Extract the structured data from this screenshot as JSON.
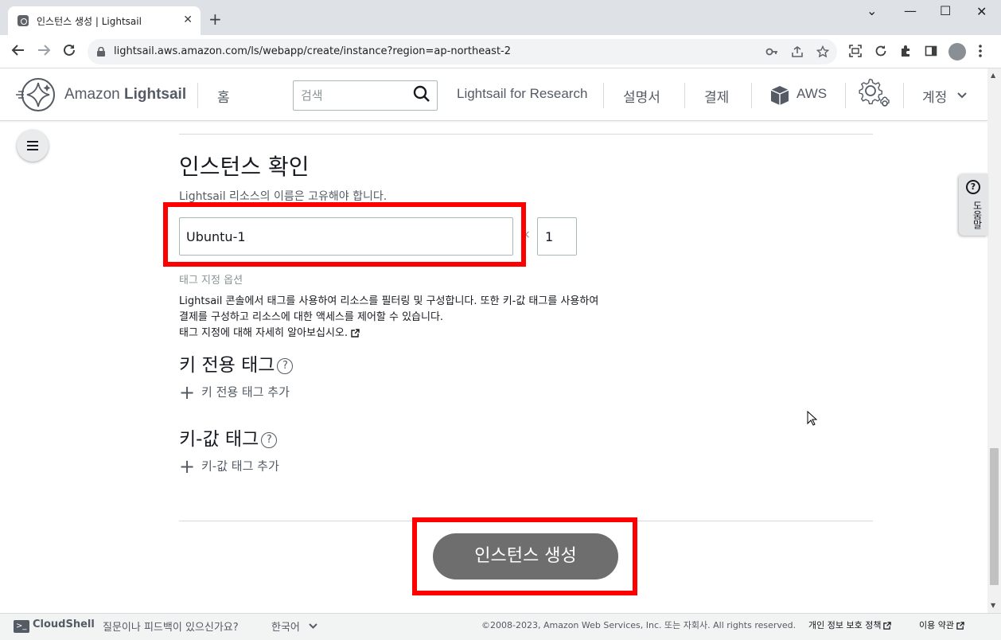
{
  "browser": {
    "tab_title": "인스턴스 생성 | Lightsail",
    "tab_close": "✕",
    "new_tab": "+",
    "url": "lightsail.aws.amazon.com/ls/webapp/create/instance?region=ap-northeast-2",
    "window_minimize": "⌄",
    "window_restore": "—",
    "window_maximize": "☐",
    "window_close": "✕"
  },
  "header": {
    "brand_light": "Amazon ",
    "brand_bold": "Lightsail",
    "home": "홈",
    "search_placeholder": "검색",
    "research": "Lightsail for Research",
    "docs": "설명서",
    "billing": "결제",
    "aws": "AWS",
    "account": "계정"
  },
  "main": {
    "section_title": "인스턴스 확인",
    "name_hint": "Lightsail 리소스의 이름은 고유해야 합니다.",
    "instance_name": "Ubuntu-1",
    "times": "×",
    "quantity": "1",
    "tag_heading": "태그 지정 옵션",
    "tag_desc_line1": "Lightsail 콘솔에서 태그를 사용하여 리소스를 필터링 및 구성합니다. 또한 키-값 태그를 사용하여",
    "tag_desc_line2": "결제를 구성하고 리소스에 대한 액세스를 제어할 수 있습니다.",
    "learn_more": "태그 지정에 대해 자세히 알아보십시오.",
    "key_only_heading": "키 전용 태그",
    "add_key_only": "키 전용 태그 추가",
    "key_value_heading": "키-값 태그",
    "add_key_value": "키-값 태그 추가",
    "create_button": "인스턴스 생성",
    "help_label": "도움말",
    "help_mark": "?",
    "qmark": "?"
  },
  "footer": {
    "cloudshell": "CloudShell",
    "feedback": "질문이나 피드백이 있으신가요?",
    "language": "한국어",
    "copyright": "©2008-2023, Amazon Web Services, Inc. 또는 자회사. All rights reserved.",
    "privacy": "개인 정보 보호 정책",
    "terms": "이용 약관"
  },
  "colors": {
    "highlight": "#ff0000",
    "create_button_bg": "#6e6e6e"
  }
}
